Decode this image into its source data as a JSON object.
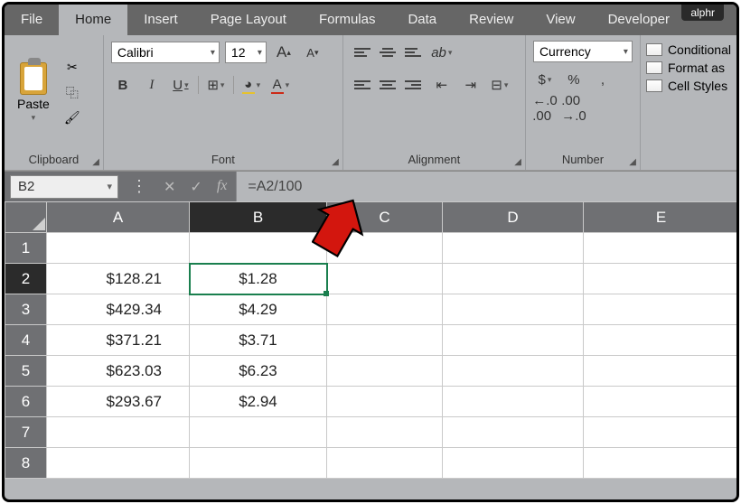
{
  "brand": "alphr",
  "tabs": {
    "file": "File",
    "home": "Home",
    "insert": "Insert",
    "page_layout": "Page Layout",
    "formulas": "Formulas",
    "data": "Data",
    "review": "Review",
    "view": "View",
    "developer": "Developer"
  },
  "ribbon": {
    "clipboard": {
      "label": "Clipboard",
      "paste": "Paste"
    },
    "font": {
      "label": "Font",
      "name": "Calibri",
      "size": "12",
      "grow": "A",
      "shrink": "A",
      "bold": "B",
      "italic": "I",
      "underline": "U"
    },
    "alignment": {
      "label": "Alignment"
    },
    "number": {
      "label": "Number",
      "format": "Currency",
      "sym_dollar": "$",
      "sym_percent": "%",
      "sym_comma": ",",
      "inc_dec": ".0",
      "dec_inc": ".00"
    },
    "styles": {
      "conditional": "Conditional",
      "format_table": "Format as",
      "cell_styles": "Cell Styles"
    }
  },
  "formula_bar": {
    "cell_ref": "B2",
    "fx": "fx",
    "formula": "=A2/100"
  },
  "columns": [
    "A",
    "B",
    "C",
    "D",
    "E"
  ],
  "active_col": "B",
  "active_row": "2",
  "rows": [
    {
      "n": "1",
      "A": "",
      "B": ""
    },
    {
      "n": "2",
      "A": "$128.21",
      "B": "$1.28"
    },
    {
      "n": "3",
      "A": "$429.34",
      "B": "$4.29"
    },
    {
      "n": "4",
      "A": "$371.21",
      "B": "$3.71"
    },
    {
      "n": "5",
      "A": "$623.03",
      "B": "$6.23"
    },
    {
      "n": "6",
      "A": "$293.67",
      "B": "$2.94"
    },
    {
      "n": "7",
      "A": "",
      "B": ""
    },
    {
      "n": "8",
      "A": "",
      "B": ""
    }
  ]
}
